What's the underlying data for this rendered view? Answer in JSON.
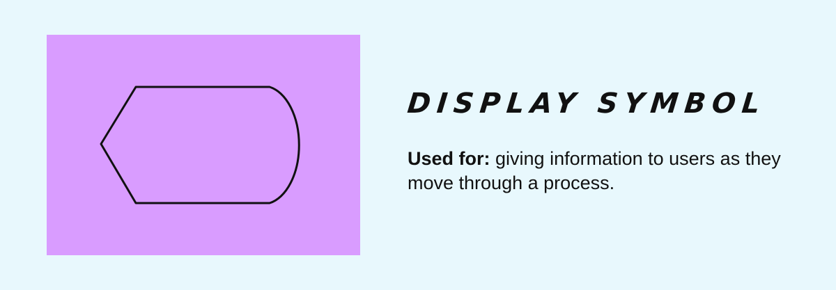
{
  "colors": {
    "background": "#e8f8fd",
    "panel": "#d99cff",
    "stroke": "#111111",
    "text": "#111111"
  },
  "title": "DISPLAY SYMBOL",
  "description": {
    "lead": "Used for:",
    "body": " giving information to users as they move through a process."
  },
  "symbol": {
    "name": "display-symbol-shape",
    "icon": "display-flowchart-shape"
  }
}
